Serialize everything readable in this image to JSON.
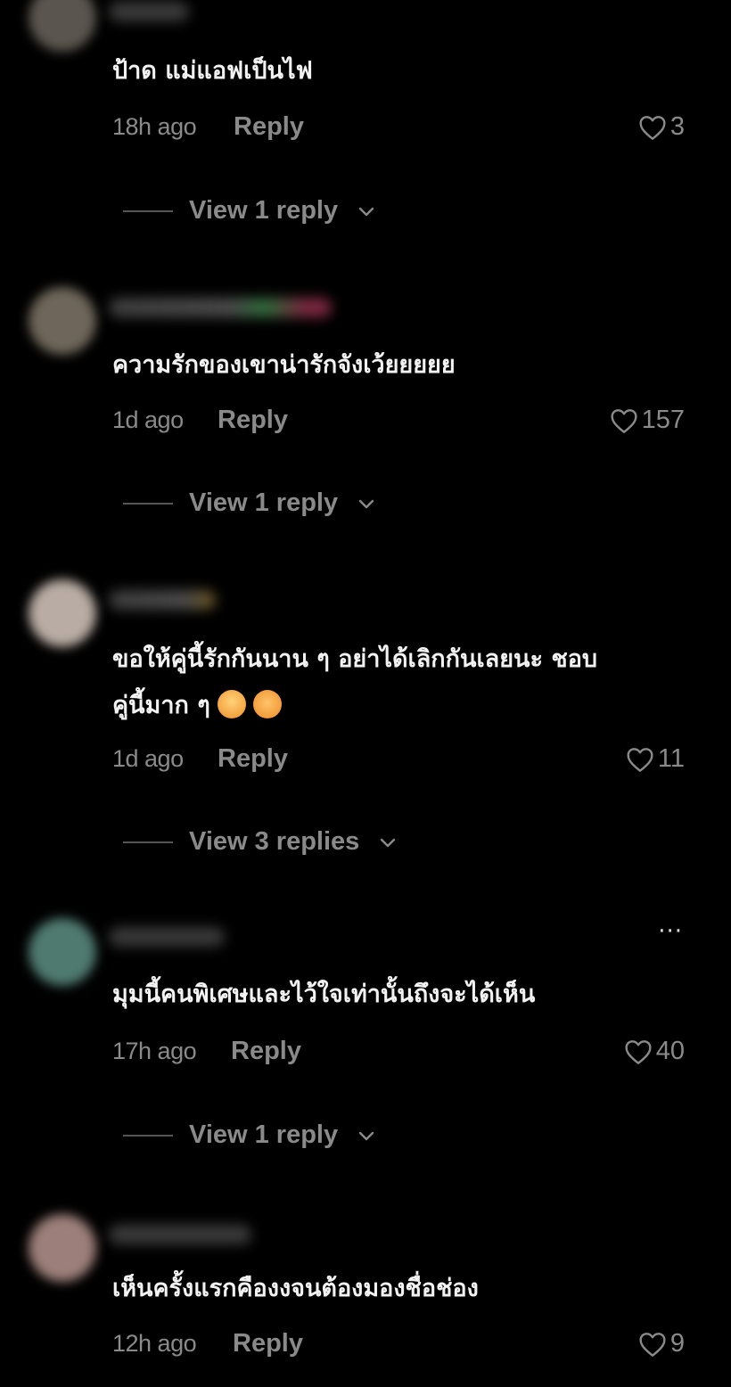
{
  "comments": [
    {
      "text": "ป้าด แม่แอฟเป็นไฟ",
      "time": "18h ago",
      "reply_label": "Reply",
      "likes": "3",
      "view_replies": "View 1 reply"
    },
    {
      "text": "ความรักของเขาน่ารักจังเว้ยยยยย",
      "time": "1d ago",
      "reply_label": "Reply",
      "likes": "157",
      "view_replies": "View 1 reply"
    },
    {
      "text_line1": "ขอให้คู่นี้รักกันนาน ๆ อย่าได้เลิกกันเลยนะ ชอบ",
      "text_line2": "คู่นี้มาก ๆ",
      "emojis": [
        "pleading-face-emoji",
        "smiling-face-with-hearts-emoji"
      ],
      "time": "1d ago",
      "reply_label": "Reply",
      "likes": "11",
      "view_replies": "View 3 replies"
    },
    {
      "text": "มุมนี้คนพิเศษและไว้ใจเท่านั้นถึงจะได้เห็น",
      "time": "17h ago",
      "reply_label": "Reply",
      "likes": "40",
      "view_replies": "View 1 reply",
      "more_label": "···"
    },
    {
      "text": "เห็นครั้งแรกคืองงจนต้องมองชื่อช่อง",
      "time": "12h ago",
      "reply_label": "Reply",
      "likes": "9"
    }
  ],
  "colors": {
    "background": "#000000",
    "text": "#f2f2f2",
    "muted": "#8a8a8a"
  }
}
